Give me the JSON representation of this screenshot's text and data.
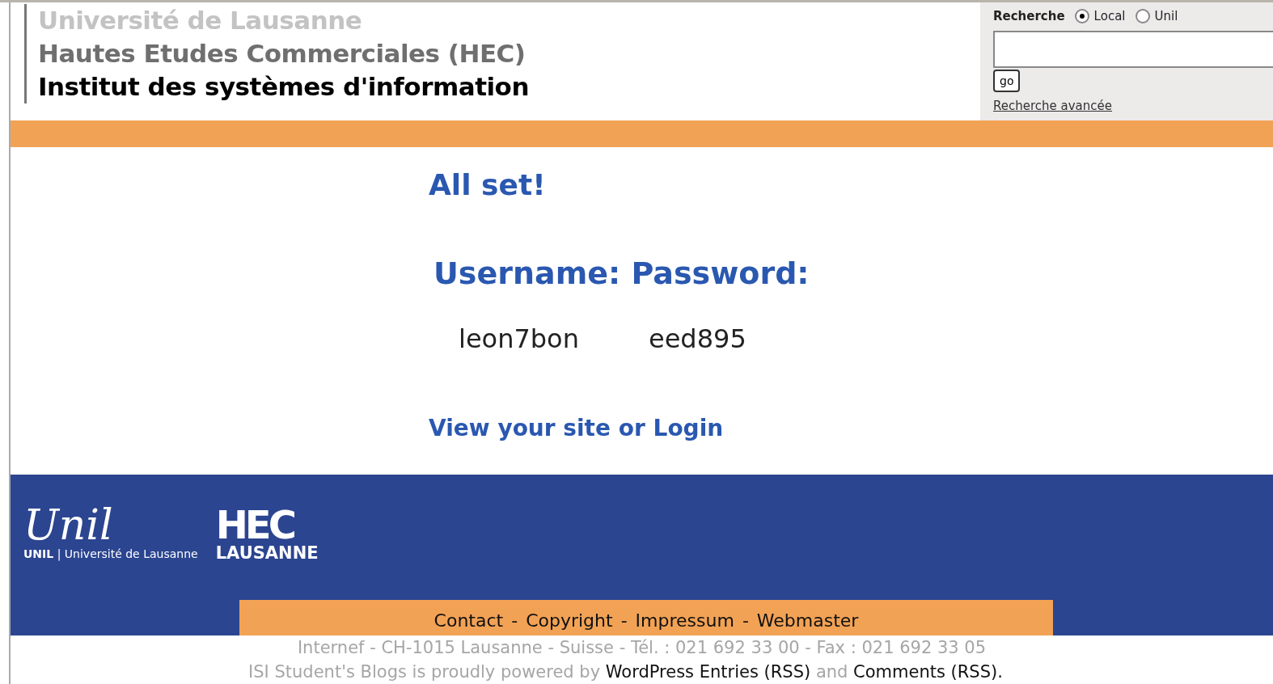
{
  "header": {
    "lines": [
      {
        "text": "Université de Lausanne",
        "kind": "faint"
      },
      {
        "text": "Hautes Etudes Commerciales (HEC)",
        "kind": "mid"
      },
      {
        "text": "Institut des systèmes d'information",
        "kind": "strong"
      }
    ]
  },
  "search": {
    "label": "Recherche",
    "options": [
      {
        "label": "Local",
        "selected": true
      },
      {
        "label": "Unil",
        "selected": false
      }
    ],
    "button": "go",
    "advanced": "Recherche avancée"
  },
  "main": {
    "heading": "All set!",
    "credentials_heading": "Username: Password:",
    "username": "leon7bon",
    "password": "eed895",
    "link": "View your site or Login"
  },
  "footer": {
    "unil_script": "Unil",
    "unil_caption_bold": "UNIL",
    "unil_caption": "| Université de Lausanne",
    "hec_logo": "HEC",
    "hec_caption": "LAUSANNE",
    "nav": [
      "Contact",
      "Copyright",
      "Impressum",
      "Webmaster"
    ],
    "separator": "-",
    "address": "Internef - CH-1015 Lausanne - Suisse - Tél. : 021 692 33 00 - Fax : 021 692 33 05",
    "powered": [
      {
        "text": "ISI Student's Blogs is proudly powered by",
        "kind": "text"
      },
      {
        "text": "WordPress",
        "kind": "link"
      },
      {
        "text": "Entries (RSS)",
        "kind": "link"
      },
      {
        "text": "and",
        "kind": "text"
      },
      {
        "text": "Comments (RSS).",
        "kind": "link"
      }
    ]
  }
}
